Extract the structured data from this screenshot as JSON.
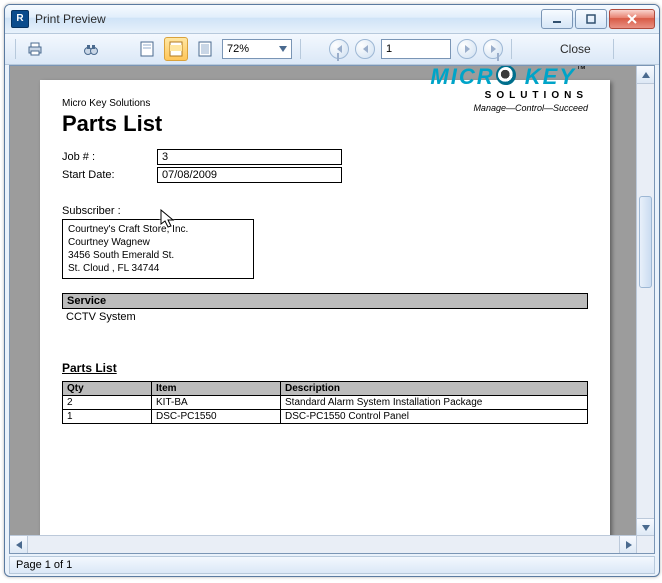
{
  "window": {
    "title": "Print Preview"
  },
  "toolbar": {
    "zoom": "72%",
    "page_input": "1",
    "close_label": "Close"
  },
  "icons": {
    "app": "R",
    "print": "printer-icon",
    "find": "binoculars-icon",
    "whole_page": "page-whole-icon",
    "page_width": "page-width-icon",
    "hundred": "page-100-icon"
  },
  "statusbar": {
    "text": "Page 1 of 1"
  },
  "report": {
    "company_small": "Micro Key Solutions",
    "title": "Parts List",
    "logo": {
      "main_left": "MICR",
      "main_right": " KEY",
      "sub": "SOLUTIONS",
      "tagline": "Manage—Control—Succeed",
      "trademark": "™"
    },
    "fields": {
      "job_label": "Job # :",
      "job_value": "3",
      "start_label": "Start Date:",
      "start_value": "07/08/2009"
    },
    "subscriber": {
      "label": "Subscriber :",
      "lines": [
        "Courtney's Craft Store, Inc.",
        "Courtney Wagnew",
        "3456 South Emerald St.",
        "St. Cloud , FL 34744"
      ]
    },
    "service": {
      "heading": "Service",
      "value": "CCTV System"
    },
    "parts": {
      "heading": "Parts List",
      "columns": [
        "Qty",
        "Item",
        "Description"
      ],
      "rows": [
        {
          "qty": "2",
          "item": "KIT-BA",
          "desc": "Standard Alarm System Installation Package"
        },
        {
          "qty": "1",
          "item": "DSC-PC1550",
          "desc": "DSC-PC1550 Control Panel"
        }
      ]
    }
  }
}
